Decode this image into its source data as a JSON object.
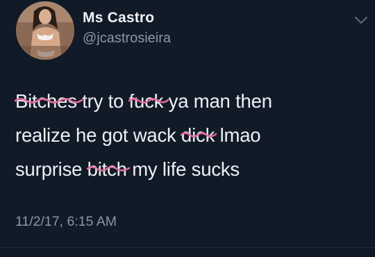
{
  "tweet": {
    "display_name": "Ms Castro",
    "handle": "@jcastrosieira",
    "text": {
      "line1": {
        "scribbled_1": "Bitches",
        "segment_1": " try to ",
        "scribbled_2": "fuck",
        "segment_2": " ya man then"
      },
      "line2": {
        "segment_1": "realize he got wack ",
        "scribbled_1": "dick",
        "segment_2": " lmao"
      },
      "line3": {
        "segment_1": "surprise ",
        "scribbled_1": "bitch",
        "segment_2": " my life sucks"
      }
    },
    "timestamp": "11/2/17, 6:15 AM"
  },
  "colors": {
    "background": "#111a27",
    "scribble": "#e46b9a",
    "secondary_text": "#8a97a6"
  },
  "icons": {
    "menu": "chevron-down-icon"
  }
}
